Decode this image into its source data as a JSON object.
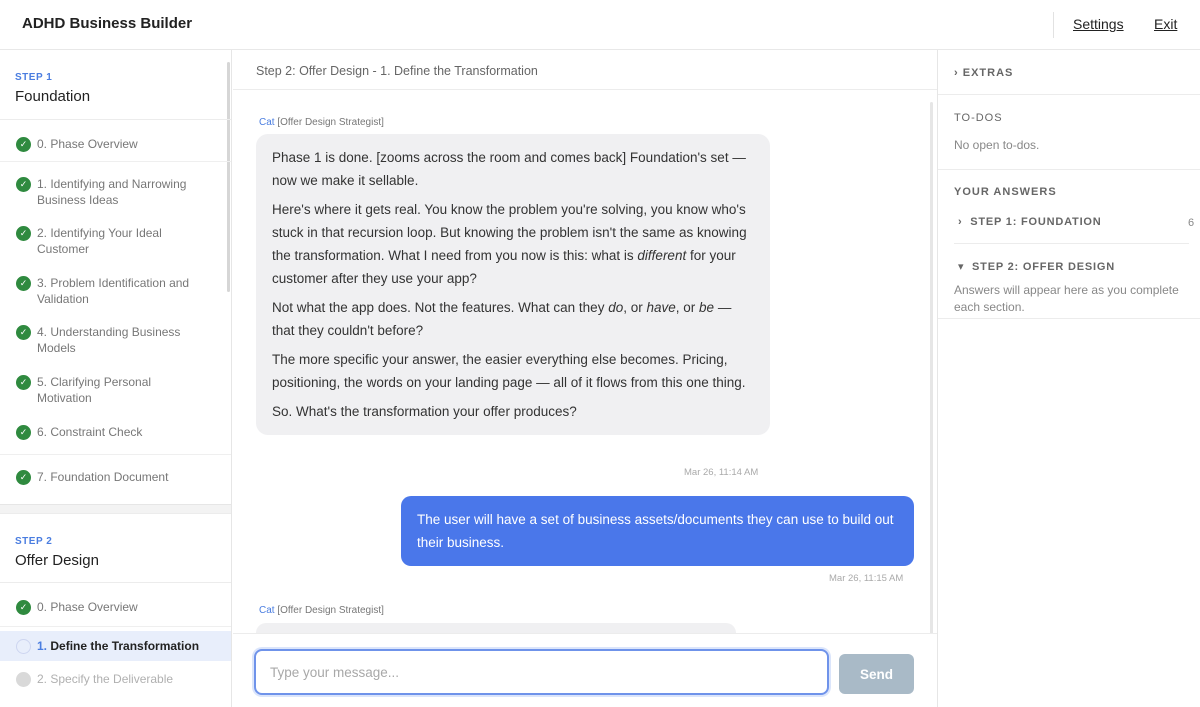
{
  "app": {
    "title": "ADHD Business Builder",
    "settings_label": "Settings",
    "exit_label": "Exit"
  },
  "sidebar": {
    "step1": {
      "label": "STEP 1",
      "title": "Foundation",
      "items": [
        {
          "label": "0. Phase Overview",
          "status": "complete"
        },
        {
          "label": "1. Identifying and Narrowing Business Ideas",
          "status": "complete"
        },
        {
          "label": "2. Identifying Your Ideal Customer",
          "status": "complete"
        },
        {
          "label": "3. Problem Identification and Validation",
          "status": "complete"
        },
        {
          "label": "4. Understanding Business Models",
          "status": "complete"
        },
        {
          "label": "5. Clarifying Personal Motivation",
          "status": "complete"
        },
        {
          "label": "6. Constraint Check",
          "status": "complete"
        },
        {
          "label": "7. Foundation Document",
          "status": "complete"
        }
      ]
    },
    "step2": {
      "label": "STEP 2",
      "title": "Offer Design",
      "items": [
        {
          "label": "0. Phase Overview",
          "status": "complete"
        },
        {
          "num": "1.",
          "text": "Define the Transformation",
          "status": "active"
        },
        {
          "label": "2. Specify the Deliverable",
          "status": "pending"
        }
      ]
    }
  },
  "main": {
    "breadcrumb": "Step 2: Offer Design - 1. Define the Transformation",
    "messages": {
      "ai1": {
        "sender_name": "Cat",
        "sender_role": "[Offer Design Strategist]",
        "p1": "Phase 1 is done. [zooms across the room and comes back] Foundation's set — now we make it sellable.",
        "p2_a": "Here's where it gets real. You know the problem you're solving, you know who's stuck in that recursion loop. But knowing the problem isn't the same as knowing the transformation. What I need from you now is this: what is ",
        "p2_em": "different",
        "p2_b": " for your customer after they use your app?",
        "p3_a": "Not what the app does. Not the features. What can they ",
        "p3_em1": "do",
        "p3_b": ", or ",
        "p3_em2": "have",
        "p3_c": ", or ",
        "p3_em3": "be",
        "p3_d": " — that they couldn't before?",
        "p4": "The more specific your answer, the easier everything else becomes. Pricing, positioning, the words on your landing page — all of it flows from this one thing.",
        "p5": "So. What's the transformation your offer produces?",
        "timestamp": "Mar 26, 11:14 AM"
      },
      "user1": {
        "text": "The user will have a set of business assets/documents they can use to build out their business.",
        "timestamp": "Mar 26, 11:15 AM"
      },
      "ai2": {
        "sender_name": "Cat",
        "sender_role": "[Offer Design Strategist]"
      }
    },
    "composer": {
      "placeholder": "Type your message...",
      "send_label": "Send"
    }
  },
  "right_panel": {
    "extras_label": "EXTRAS",
    "todos_title": "TO-DOS",
    "todos_empty": "No open to-dos.",
    "answers_title": "YOUR ANSWERS",
    "step1_label": "STEP 1: FOUNDATION",
    "step1_count": "6",
    "step2_label": "STEP 2: OFFER DESIGN",
    "step2_empty": "Answers will appear here as you complete each section."
  },
  "colors": {
    "accent": "#4a77ea",
    "complete_check": "#2f8a3f",
    "active_bg": "#e8eefb",
    "send_disabled": "#a9bac7"
  }
}
